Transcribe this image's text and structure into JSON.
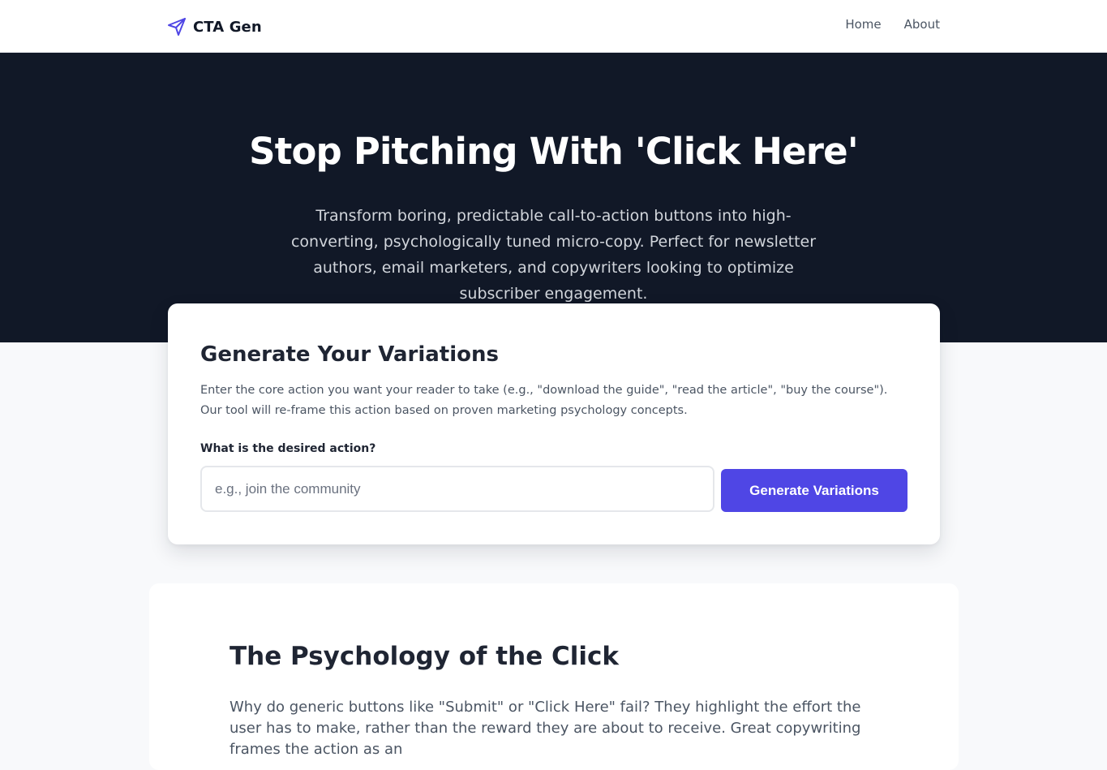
{
  "brand": {
    "name": "CTA Gen",
    "icon": "paper-plane-icon",
    "accent": "#4f46e5"
  },
  "nav": {
    "items": [
      "Home",
      "About"
    ]
  },
  "hero": {
    "title": "Stop Pitching With 'Click Here'",
    "subtitle": "Transform boring, predictable call-to-action buttons into high-converting, psychologically tuned micro-copy. Perfect for newsletter authors, email marketers, and copywriters looking to optimize subscriber engagement.",
    "background": "#111827"
  },
  "generator": {
    "title": "Generate Your Variations",
    "description": "Enter the core action you want your reader to take (e.g., \"download the guide\", \"read the article\", \"buy the course\"). Our tool will re-frame this action based on proven marketing psychology concepts.",
    "field_label": "What is the desired action?",
    "field_value": "",
    "field_placeholder": "e.g., join the community",
    "button_label": "Generate Variations"
  },
  "article": {
    "title": "The Psychology of the Click",
    "body": "Why do generic buttons like \"Submit\" or \"Click Here\" fail? They highlight the effort the user has to make, rather than the reward they are about to receive. Great copywriting frames the action as an"
  }
}
